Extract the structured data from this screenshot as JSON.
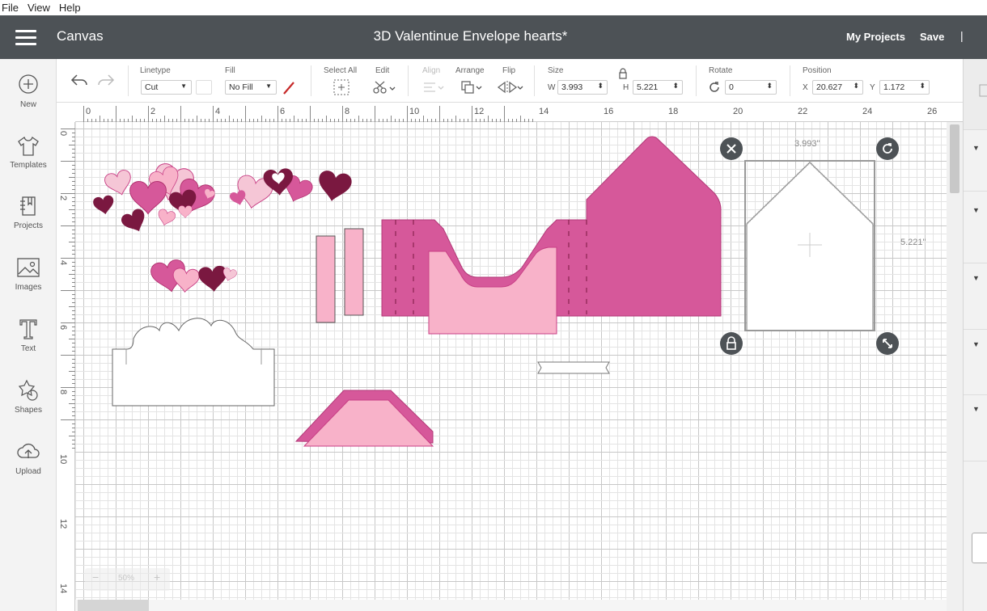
{
  "menu": [
    "File",
    "View",
    "Help"
  ],
  "header": {
    "section": "Canvas",
    "title": "3D Valentinue Envelope hearts*",
    "my_projects": "My Projects",
    "save": "Save",
    "separator": "|"
  },
  "sidebar": [
    {
      "label": "New",
      "icon": "plus-circle-icon"
    },
    {
      "label": "Templates",
      "icon": "tshirt-icon"
    },
    {
      "label": "Projects",
      "icon": "projects-icon"
    },
    {
      "label": "Images",
      "icon": "image-icon"
    },
    {
      "label": "Text",
      "icon": "text-icon"
    },
    {
      "label": "Shapes",
      "icon": "shapes-icon"
    },
    {
      "label": "Upload",
      "icon": "upload-cloud-icon"
    }
  ],
  "toolbar": {
    "linetype_label": "Linetype",
    "linetype_value": "Cut",
    "fill_label": "Fill",
    "fill_value": "No Fill",
    "select_all_label": "Select All",
    "edit_label": "Edit",
    "align_label": "Align",
    "arrange_label": "Arrange",
    "flip_label": "Flip",
    "size_label": "Size",
    "w_label": "W",
    "w_value": "3.993",
    "h_label": "H",
    "h_value": "5.221",
    "rotate_label": "Rotate",
    "rotate_value": "0",
    "position_label": "Position",
    "x_label": "X",
    "x_value": "20.627",
    "y_label": "Y",
    "y_value": "1.172"
  },
  "ruler": {
    "top": [
      "0",
      "2",
      "4",
      "6",
      "8",
      "10",
      "12",
      "14",
      "16",
      "18",
      "20",
      "22",
      "24",
      "26"
    ],
    "left": [
      "0",
      "2",
      "4",
      "6",
      "8",
      "10",
      "12",
      "14"
    ]
  },
  "selection": {
    "width_label": "3.993\"",
    "height_label": "5.221\""
  },
  "zoom": {
    "level": "50%",
    "minus": "−",
    "plus": "+"
  },
  "colors": {
    "header_bg": "#4d5256",
    "magenta": "#d6589a",
    "dark_magenta": "#c83f85",
    "light_pink": "#f8b2c9",
    "pale_pink": "#f5c6d6",
    "burgundy": "#7a1840",
    "grid_minor": "#e4e4e4",
    "grid_major": "#c8c8c8"
  }
}
